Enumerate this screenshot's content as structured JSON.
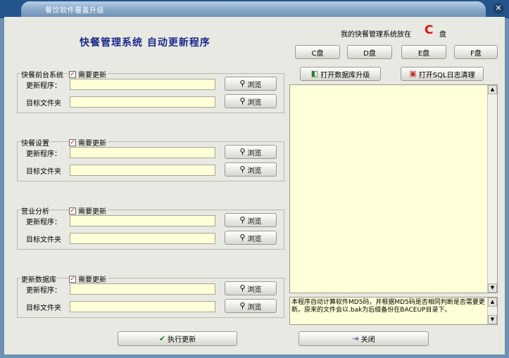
{
  "window": {
    "title": "餐饮软件覆盖升级"
  },
  "heading": "快餐管理系统  自动更新程序",
  "drive_selector": {
    "note": "我的快餐管理系统放在",
    "selected_letter": "C",
    "unit": "盘",
    "buttons": [
      "C盘",
      "D盘",
      "E盘",
      "F盘"
    ]
  },
  "groups": [
    {
      "title": "快餐前台系统",
      "check_label": "需要更新",
      "checked": true,
      "program_label": "更新程序：",
      "folder_label": "目标文件夹",
      "browse_label": "浏览"
    },
    {
      "title": "快餐设置",
      "check_label": "需要更新",
      "checked": true,
      "program_label": "更新程序：",
      "folder_label": "目标文件夹",
      "browse_label": "浏览"
    },
    {
      "title": "营业分析",
      "check_label": "需要更新",
      "checked": true,
      "program_label": "更新程序：",
      "folder_label": "目标文件夹",
      "browse_label": "浏览"
    },
    {
      "title": "更新数据库",
      "check_label": "需要更新",
      "checked": true,
      "program_label": "更新程序：",
      "folder_label": "目标文件夹",
      "browse_label": "浏览"
    }
  ],
  "tools": {
    "open_db_upgrade": "打开数据库升级",
    "open_sql_log_cleanup": "打开SQL日志清理"
  },
  "note_text": "本程序自动计算软件MD5码，并根据MD5码是否相同判断是否需要更新。原来的文件会以.bak为后缀备份在BACEUP目录下。",
  "actions": {
    "execute": "执行更新",
    "close": "关闭"
  },
  "colors": {
    "title_bar": "#24548c",
    "panel": "#e9e9e3",
    "field": "#ffffd8",
    "heading": "#1a2a8c",
    "drive_letter": "#e01010"
  }
}
